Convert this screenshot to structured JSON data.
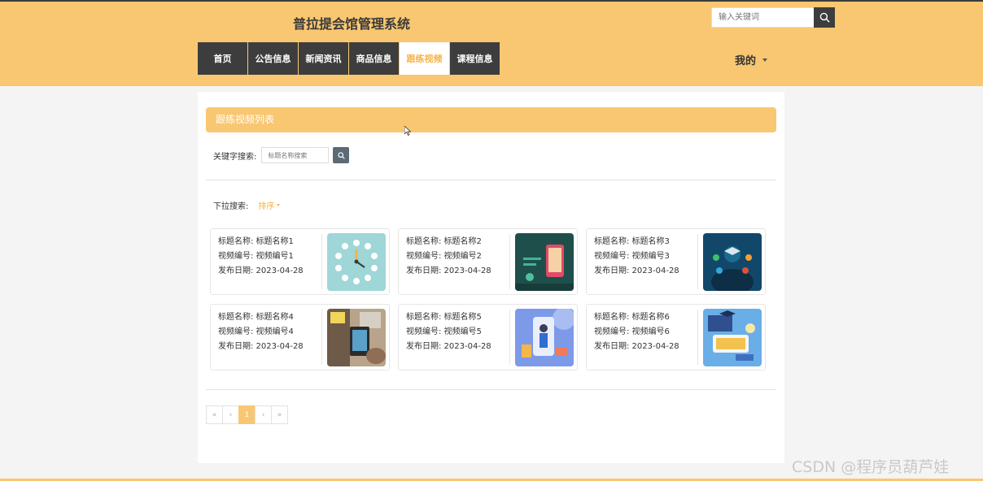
{
  "header": {
    "site_title": "普拉提会馆管理系统",
    "search_placeholder": "输入关键词",
    "search_icon": "search-icon",
    "user_menu": "我的"
  },
  "nav": [
    {
      "label": "首页",
      "active": false
    },
    {
      "label": "公告信息",
      "active": false
    },
    {
      "label": "新闻资讯",
      "active": false
    },
    {
      "label": "商品信息",
      "active": false
    },
    {
      "label": "跟练视频",
      "active": true
    },
    {
      "label": "课程信息",
      "active": false
    }
  ],
  "main": {
    "section_title": "跟练视频列表",
    "keyword_label": "关键字搜索:",
    "keyword_placeholder": "标题名称搜索",
    "dropdown_label": "下拉搜索:",
    "sort_label": "排序"
  },
  "cards": [
    {
      "title": "标题名称: 标题名称1",
      "code": "视频编号: 视频编号1",
      "date": "发布日期: 2023-04-28",
      "thumb": "clock-icons-thumbnail"
    },
    {
      "title": "标题名称: 标题名称2",
      "code": "视频编号: 视频编号2",
      "date": "发布日期: 2023-04-28",
      "thumb": "phone-lecture-thumbnail"
    },
    {
      "title": "标题名称: 标题名称3",
      "code": "视频编号: 视频编号3",
      "date": "发布日期: 2023-04-28",
      "thumb": "graduate-icons-thumbnail"
    },
    {
      "title": "标题名称: 标题名称4",
      "code": "视频编号: 视频编号4",
      "date": "发布日期: 2023-04-28",
      "thumb": "tablet-study-thumbnail"
    },
    {
      "title": "标题名称: 标题名称5",
      "code": "视频编号: 视频编号5",
      "date": "发布日期: 2023-04-28",
      "thumb": "phone-teacher-thumbnail"
    },
    {
      "title": "标题名称: 标题名称6",
      "code": "视频编号: 视频编号6",
      "date": "发布日期: 2023-04-28",
      "thumb": "online-class-thumbnail"
    }
  ],
  "pagination": {
    "first": "«",
    "prev": "‹",
    "current": "1",
    "next": "›",
    "last": "»"
  },
  "watermark": "CSDN @程序员葫芦娃",
  "colors": {
    "accent": "#f9c772",
    "accent_text": "#f4b44a",
    "nav_bg": "#3d3d3d"
  }
}
